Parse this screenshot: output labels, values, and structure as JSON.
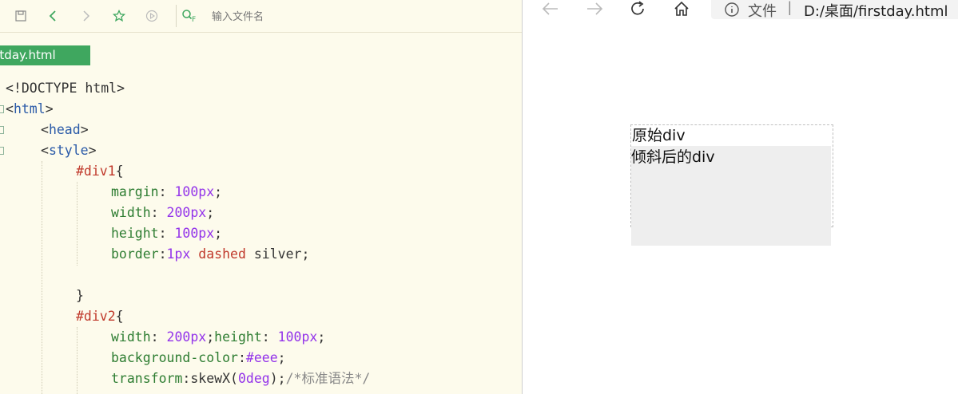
{
  "editor": {
    "search": {
      "placeholder": "输入文件名"
    },
    "file_tab": {
      "label": "firstday.html"
    },
    "code_lines": {
      "l1": {
        "text": "<!DOCTYPE html>"
      },
      "l2": {
        "open": "<",
        "tag": "html",
        "close": ">"
      },
      "l3": {
        "open": "<",
        "tag": "head",
        "close": ">"
      },
      "l4": {
        "open": "<",
        "tag": "style",
        "close": ">"
      },
      "l5": {
        "sel": "#div1",
        "brace": "{"
      },
      "l6": {
        "prop": "margin",
        "colon": ": ",
        "num": "100px",
        "semi": ";"
      },
      "l7": {
        "prop": "width",
        "colon": ": ",
        "num": "200px",
        "semi": ";"
      },
      "l8": {
        "prop": "height",
        "colon": ": ",
        "num": "100px",
        "semi": ";"
      },
      "l9": {
        "prop": "border",
        "colon": ":",
        "num": "1px",
        "sp": " ",
        "val": "dashed",
        "rest": " silver;"
      },
      "l10": {
        "text": "}"
      },
      "l11": {
        "sel": "#div2",
        "brace": "{"
      },
      "l12": {
        "prop": "width",
        "colon": ": ",
        "num": "200px",
        "semi": ";",
        "prop2": "height",
        "colon2": ": ",
        "num2": "100px",
        "semi2": ";"
      },
      "l13": {
        "prop": "background-color",
        "colon": ":",
        "num": "#eee",
        "semi": ";"
      },
      "l14": {
        "prop": "transform",
        "colon": ":",
        "fn": "skewX(",
        "num": "0deg",
        "fnclose": ");",
        "comment": "/*标准语法*/"
      }
    }
  },
  "browser": {
    "address": {
      "label": "文件",
      "separator": "|",
      "url": "D:/桌面/firstday.html"
    },
    "page": {
      "div1_text": "原始div",
      "div2_text": "倾斜后的div"
    }
  },
  "icons": {
    "save": "save-icon",
    "back": "chevron-left-icon",
    "forward": "chevron-right-icon",
    "star": "star-icon",
    "play": "play-icon",
    "search": "search-file-icon",
    "browser_back": "arrow-left-icon",
    "browser_forward": "arrow-right-icon",
    "refresh": "refresh-icon",
    "home": "home-icon",
    "info": "info-icon"
  },
  "colors": {
    "editor_bg": "#fdfbec",
    "tab_green": "#3fa75f",
    "tag_blue": "#2a5aa8",
    "selector_red": "#c0392b",
    "property_green": "#2e7d32",
    "number_purple": "#9333ea",
    "div2_bg": "#eee"
  }
}
